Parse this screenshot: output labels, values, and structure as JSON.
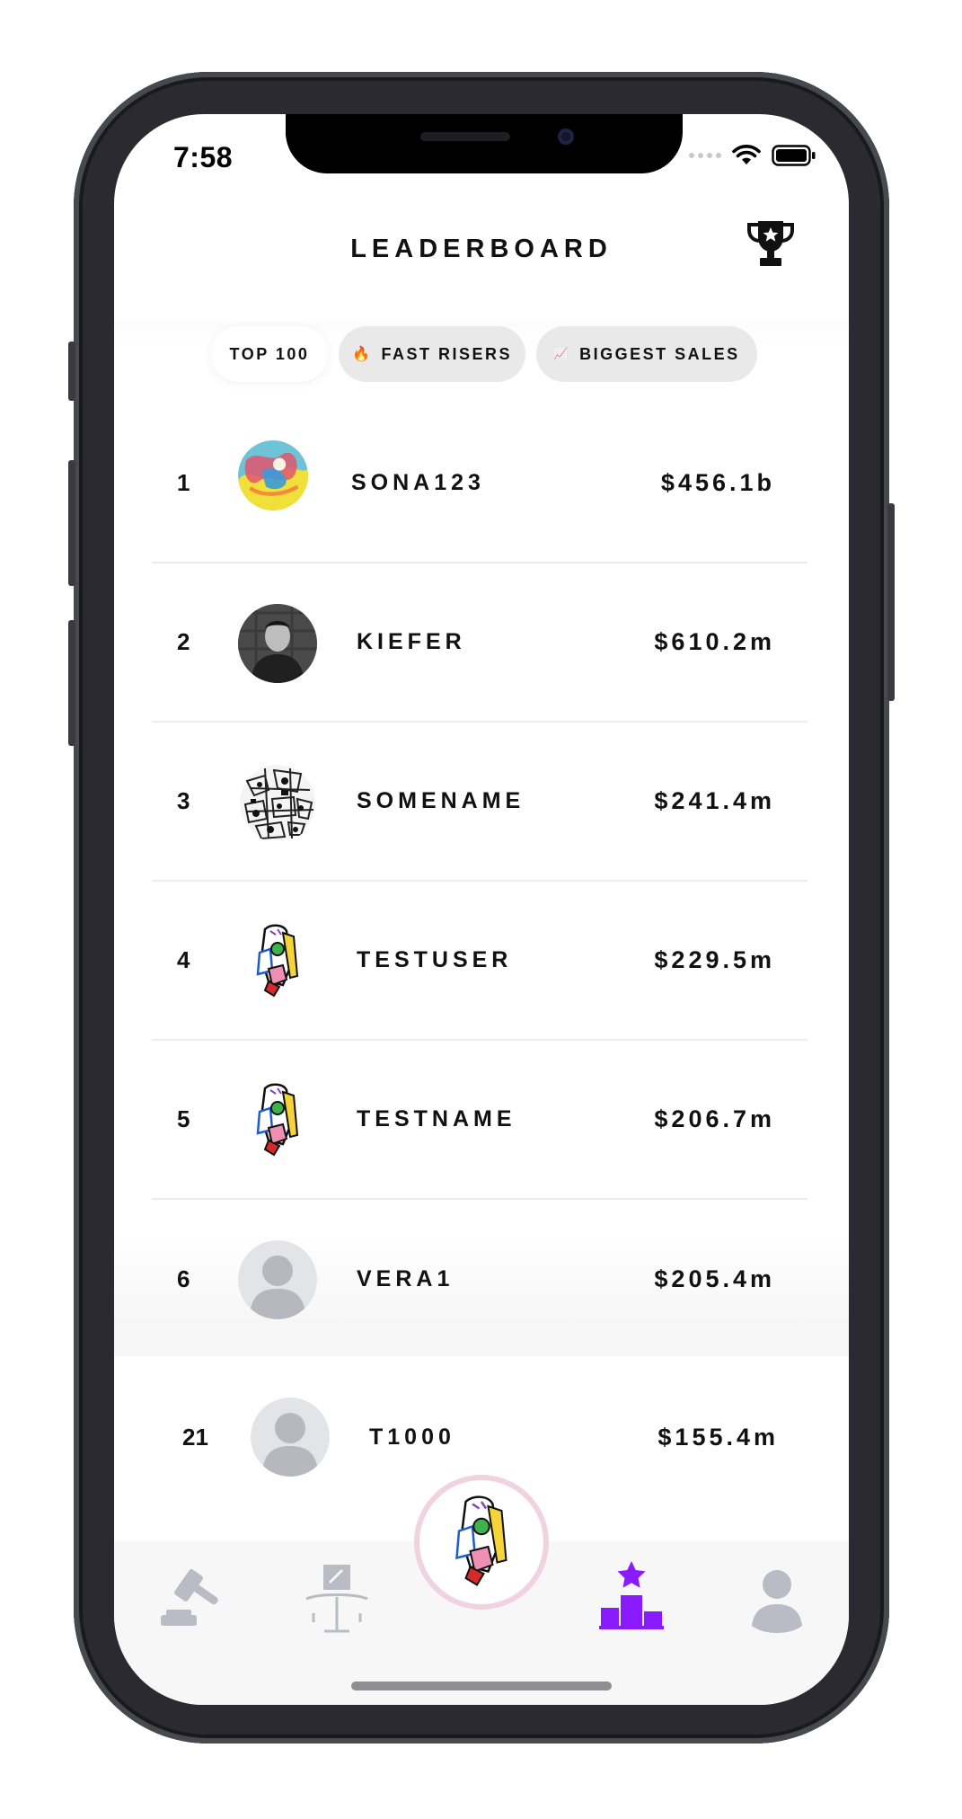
{
  "status_bar": {
    "time": "7:58"
  },
  "header": {
    "title": "LEADERBOARD",
    "trophy_icon": "trophy-icon"
  },
  "tabs": [
    {
      "label": "TOP 100",
      "icon": "",
      "active": true
    },
    {
      "label": "FAST RISERS",
      "icon": "🔥",
      "active": false
    },
    {
      "label": "BIGGEST SALES",
      "icon": "📈",
      "active": false
    }
  ],
  "leaderboard": [
    {
      "rank": "1",
      "username": "SONA123",
      "value": "$456.1b",
      "avatar": "abstract-art-avatar"
    },
    {
      "rank": "2",
      "username": "KIEFER",
      "value": "$610.2m",
      "avatar": "photo-avatar"
    },
    {
      "rank": "3",
      "username": "SOMENAME",
      "value": "$241.4m",
      "avatar": "sketch-avatar"
    },
    {
      "rank": "4",
      "username": "TESTUSER",
      "value": "$229.5m",
      "avatar": "cubist-figure-avatar"
    },
    {
      "rank": "5",
      "username": "TESTNAME",
      "value": "$206.7m",
      "avatar": "cubist-figure-avatar"
    },
    {
      "rank": "6",
      "username": "VERA1",
      "value": "$205.4m",
      "avatar": "default-user-avatar"
    }
  ],
  "current_user": {
    "rank": "21",
    "username": "T1000",
    "value": "$155.4m",
    "avatar": "default-user-avatar"
  },
  "bottom_nav": [
    {
      "name": "auctions",
      "icon": "gavel-icon",
      "active": false
    },
    {
      "name": "gallery",
      "icon": "easel-icon",
      "active": false
    },
    {
      "name": "home",
      "icon": "cubist-figure-icon",
      "active": false
    },
    {
      "name": "leaderboard",
      "icon": "podium-star-icon",
      "active": true
    },
    {
      "name": "profile",
      "icon": "user-icon",
      "active": false
    }
  ],
  "colors": {
    "accent": "#8b1bff",
    "inactive_icon": "#b9bcc4",
    "tab_inactive": "#e9e9ea",
    "center_ring": "#f0d3de"
  }
}
